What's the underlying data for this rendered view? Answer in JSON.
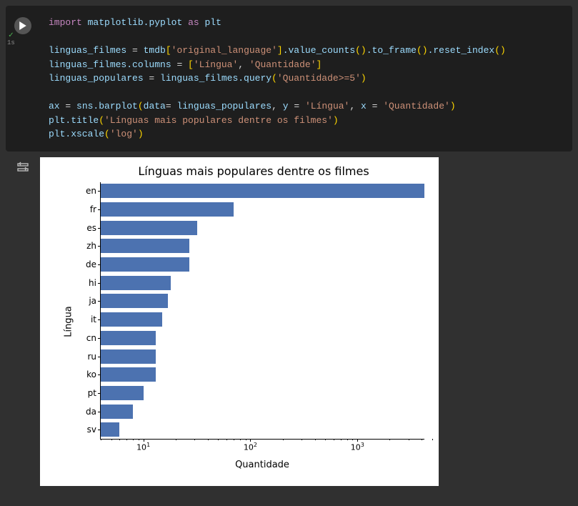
{
  "cell": {
    "status_icon": "check",
    "exec_time": "1s",
    "code": {
      "l1_import": "import",
      "l1_mod": "matplotlib.pyplot",
      "l1_as": "as",
      "l1_alias": "plt",
      "l3_var": "linguas_filmes",
      "l3_eq": " = ",
      "l3_tmdb": "tmdb",
      "l3_key": "'original_language'",
      "l3_chain": ".value_counts().to_frame().reset_index()",
      "l4_cols": "linguas_filmes.columns",
      "l4_eq": " = ",
      "l4_lingua": "'Língua'",
      "l4_qtd": "'Quantidade'",
      "l5_var": "linguas_populares",
      "l5_eq": " = ",
      "l5_src": "linguas_filmes",
      "l5_fn": ".query(",
      "l5_arg": "'Quantidade>=5'",
      "l7_ax": "ax",
      "l7_eq": " = ",
      "l7_sns": "sns.barplot(",
      "l7_data": "data= ",
      "l7_dataval": "linguas_populares",
      "l7_y": ", y = ",
      "l7_yval": "'Língua'",
      "l7_x": ", x = ",
      "l7_xval": "'Quantidade'",
      "l8_title": "plt.title(",
      "l8_titleval": "'Línguas mais populares dentre os filmes'",
      "l9_xscale": "plt.xscale(",
      "l9_xscaleval": "'log'"
    }
  },
  "chart_data": {
    "type": "bar",
    "orientation": "horizontal",
    "title": "Línguas mais populares dentre os filmes",
    "xlabel": "Quantidade",
    "ylabel": "Língua",
    "xscale": "log",
    "xlim": [
      4,
      5000
    ],
    "categories": [
      "en",
      "fr",
      "es",
      "zh",
      "de",
      "hi",
      "ja",
      "it",
      "cn",
      "ru",
      "ko",
      "pt",
      "da",
      "sv"
    ],
    "values": [
      4500,
      70,
      32,
      27,
      27,
      18,
      17,
      15,
      13,
      13,
      13,
      10,
      8,
      6
    ],
    "x_ticks": [
      {
        "value": 10,
        "label_base": "10",
        "label_exp": "1"
      },
      {
        "value": 100,
        "label_base": "10",
        "label_exp": "2"
      },
      {
        "value": 1000,
        "label_base": "10",
        "label_exp": "3"
      }
    ]
  }
}
